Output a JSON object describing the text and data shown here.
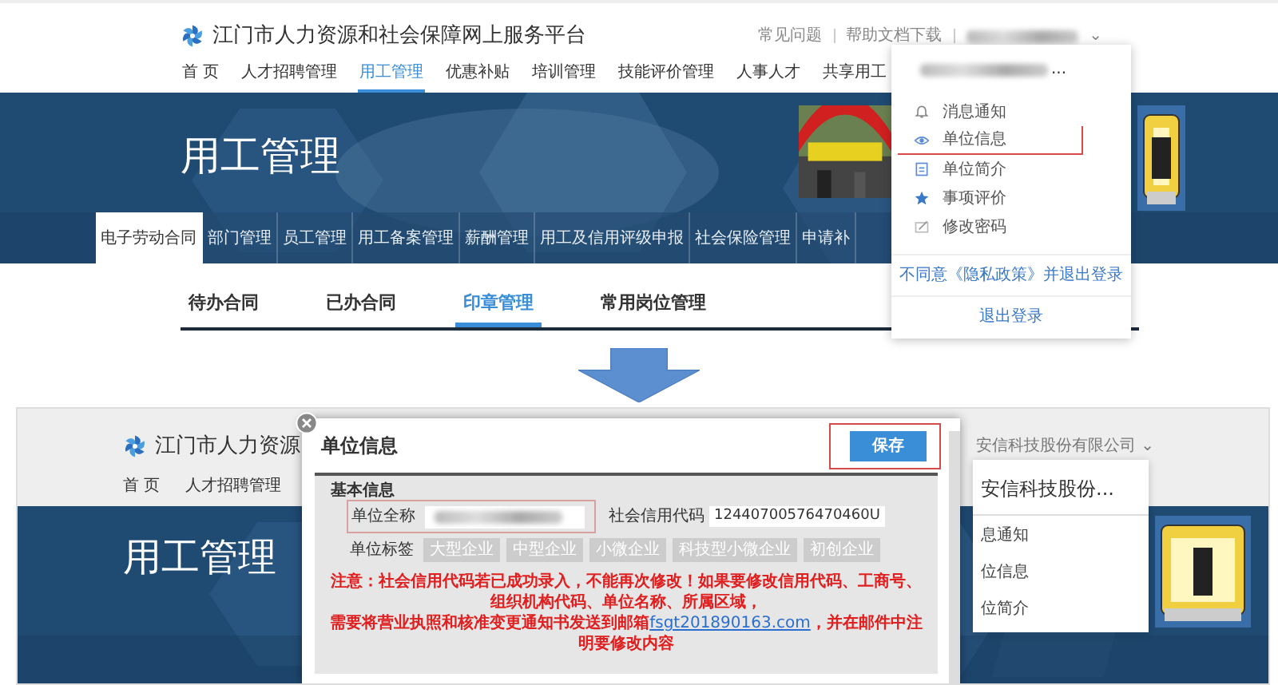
{
  "top_screenshot": {
    "header": {
      "site_title": "江门市人力资源和社会保障网上服务平台",
      "links": [
        "常见问题",
        "帮助文档下载"
      ],
      "account_caret": "⌄"
    },
    "nav": [
      {
        "label": "首 页",
        "selected": false
      },
      {
        "label": "人才招聘管理",
        "selected": false
      },
      {
        "label": "用工管理",
        "selected": true
      },
      {
        "label": "优惠补贴",
        "selected": false
      },
      {
        "label": "培训管理",
        "selected": false
      },
      {
        "label": "技能评价管理",
        "selected": false
      },
      {
        "label": "人事人才",
        "selected": false
      },
      {
        "label": "共享用工",
        "selected": false
      }
    ],
    "banner": {
      "title": "用工管理"
    },
    "sub_tabs": [
      {
        "label": "电子劳动合同",
        "selected": true
      },
      {
        "label": "部门管理",
        "selected": false
      },
      {
        "label": "员工管理",
        "selected": false
      },
      {
        "label": "用工备案管理",
        "selected": false
      },
      {
        "label": "薪酬管理",
        "selected": false
      },
      {
        "label": "用工及信用评级申报",
        "selected": false
      },
      {
        "label": "社会保险管理",
        "selected": false
      },
      {
        "label": "申请补",
        "selected": false
      }
    ],
    "content_tabs": [
      {
        "label": "待办合同",
        "selected": false
      },
      {
        "label": "已办合同",
        "selected": false
      },
      {
        "label": "印章管理",
        "selected": true
      },
      {
        "label": "常用岗位管理",
        "selected": false
      }
    ],
    "user_menu": {
      "name_tail": "...",
      "items": [
        {
          "label": "消息通知",
          "highlighted": false
        },
        {
          "label": "单位信息",
          "highlighted": true
        },
        {
          "label": "单位简介",
          "highlighted": false
        },
        {
          "label": "事项评价",
          "highlighted": false
        },
        {
          "label": "修改密码",
          "highlighted": false
        }
      ],
      "privacy_link": "不同意《隐私政策》并退出登录",
      "logout": "退出登录"
    }
  },
  "bottom_screenshot": {
    "header": {
      "site_title": "江门市人力资源",
      "company": "安信科技股份有限公司",
      "caret": "⌄"
    },
    "nav": [
      "首 页",
      "人才招聘管理"
    ],
    "banner": {
      "title": "用工管理"
    },
    "user_menu": {
      "company": "安信科技股份...",
      "items": [
        "息通知",
        "位信息",
        "位简介"
      ]
    },
    "dialog": {
      "title": "单位信息",
      "save_button": "保存",
      "save_highlighted": true,
      "section": "基本信息",
      "name_field": {
        "label": "单位全称",
        "highlighted": true
      },
      "credit_code": {
        "label": "社会信用代码",
        "value": "12440700576470460U"
      },
      "tags_label": "单位标签",
      "tags": [
        {
          "label": "大型企业",
          "disabled": true
        },
        {
          "label": "中型企业",
          "disabled": true
        },
        {
          "label": "小微企业",
          "disabled": true
        },
        {
          "label": "科技型小微企业",
          "disabled": true
        },
        {
          "label": "初创企业",
          "disabled": true
        }
      ],
      "notice_line_1": "注意：社会信用代码若已成功录入，不能再次修改！如果要修改信用代码、工商号、组织机构代码、单位名称、所属区域，",
      "notice_line_2": "需要将营业执照和核准变更通知书发送到邮箱",
      "notice_email": "fsgt201890163.com",
      "notice_line_2_end": "，并在邮件中注明要修改内容"
    }
  }
}
